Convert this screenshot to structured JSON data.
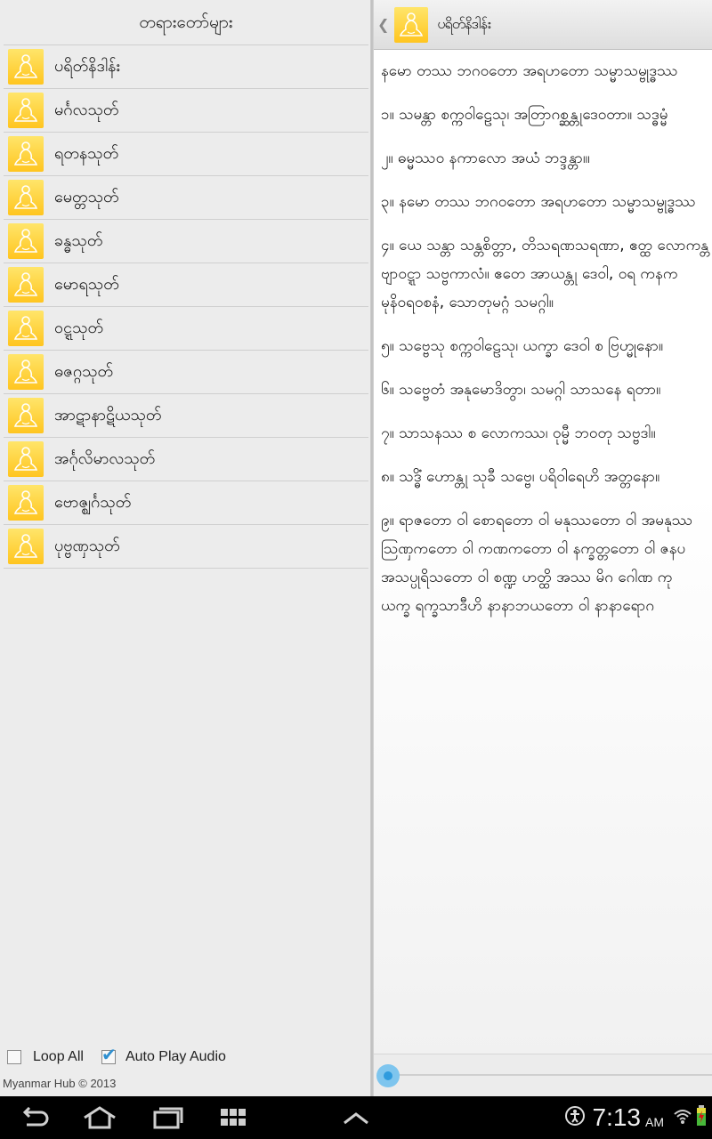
{
  "left_pane": {
    "title": "တရားတော်များ",
    "chapters": [
      {
        "label": "ပရိတ်နိဒါန်း",
        "icon": "buddha-icon"
      },
      {
        "label": "မင်္ဂလသုတ်",
        "icon": "buddha-icon"
      },
      {
        "label": "ရတနသုတ်",
        "icon": "buddha-icon"
      },
      {
        "label": "မေတ္တသုတ်",
        "icon": "buddha-icon"
      },
      {
        "label": "ခန္ဓသုတ်",
        "icon": "buddha-icon"
      },
      {
        "label": "မောရသုတ်",
        "icon": "buddha-icon"
      },
      {
        "label": "ဝဋ္ဋသုတ်",
        "icon": "buddha-icon"
      },
      {
        "label": "ဓဇဂ္ဂသုတ်",
        "icon": "buddha-icon"
      },
      {
        "label": "အာဋာနာဋိယသုတ်",
        "icon": "buddha-icon"
      },
      {
        "label": "အင်္ဂုလိမာလသုတ်",
        "icon": "buddha-icon"
      },
      {
        "label": "ဗောဇ္ဈင်္ဂသုတ်",
        "icon": "buddha-icon"
      },
      {
        "label": "ပုဗ္ဗဏှသုတ်",
        "icon": "buddha-icon"
      }
    ],
    "options": {
      "loop_all_label": "Loop All",
      "loop_all_checked": false,
      "auto_play_label": "Auto Play Audio",
      "auto_play_checked": true
    },
    "copyright": "Myanmar Hub © 2013"
  },
  "right_pane": {
    "back_icon": "chevron-left-icon",
    "header_icon": "buddha-icon",
    "header_title": "ပရိတ်နိဒါန်း",
    "verses": [
      [
        "နမော တဿ ဘဂဝတော အရဟတော သမ္မာသမ္ဗုဒ္ဓဿ"
      ],
      [
        "၁။ သမန္တာ စက္ကဝါဠေသု၊ အတြာဂစ္ဆန္တုဒေဝတာ။ သဒ္ဓမ္မံ"
      ],
      [
        "၂။ ဓမ္မဿဝ နကာလော အယံ ဘဒ္ဒန္တာ၊။"
      ],
      [
        "၃။ နမော တဿ ဘဂဝတော အရဟတော သမ္မာသမ္ဗုဒ္ဓဿ"
      ],
      [
        "၄။ ယေ သန္တာ သန္တစိတ္တာ, တိသရဏသရဏာ, ဧတ္ထ လောကန္တ",
        "ဗျာဝဋ္ဋာ သဗ္ဗကာလံ။ ဧတေ အာယန္တု ဒေဝါ, ဝရ ကနက",
        "မုနိဝရဝစနံ, သောတုမဂ္ဂံ သမဂ္ဂါ။"
      ],
      [
        "၅။ သဗ္ဗေသု စက္ကဝါဠေသု၊ ယက္ခာ ဒေဝါ စ ဗြဟ္မုနော။"
      ],
      [
        "၆။ သဗ္ဗေတံ အနုမောဒိတွာ၊ သမဂ္ဂါ သာသနေ ရတာ။"
      ],
      [
        "၇။ သာသနဿ စ လောကဿ၊ ဝုမ္မီ ဘဝတု သဗ္ဗဒါ။"
      ],
      [
        "၈။ သဒ္ဓိံ ဟောန္တု သုခီ သဗ္ဗေ၊ ပရိဝါရေဟိ အတ္တနော။"
      ],
      [
        "၉။ ရာဇတော ဝါ စောရတော ဝါ မနုဿတော ဝါ အမနုဿ",
        "ဩဏှကတော ဝါ ကဏကတော ဝါ နက္ခတ္တတော ဝါ ဇနပ",
        "အသပ္ပုရိသတော ဝါ စဏ္ဍ ဟတ္ထိ အဿ မိဂ ဂေါဏ ကု",
        "ယက္ခ ရက္ခသာဒီဟိ နာနာဘယတော ဝါ နာနာရောဂ"
      ]
    ],
    "playback_progress": 0
  },
  "system_bar": {
    "nav_icons": [
      "back-icon",
      "home-icon",
      "recent-apps-icon",
      "apps-grid-icon",
      "chevron-up-icon"
    ],
    "status_icons": [
      "accessibility-icon",
      "wifi-icon",
      "battery-icon"
    ],
    "time": "7:13",
    "ampm": "AM"
  }
}
